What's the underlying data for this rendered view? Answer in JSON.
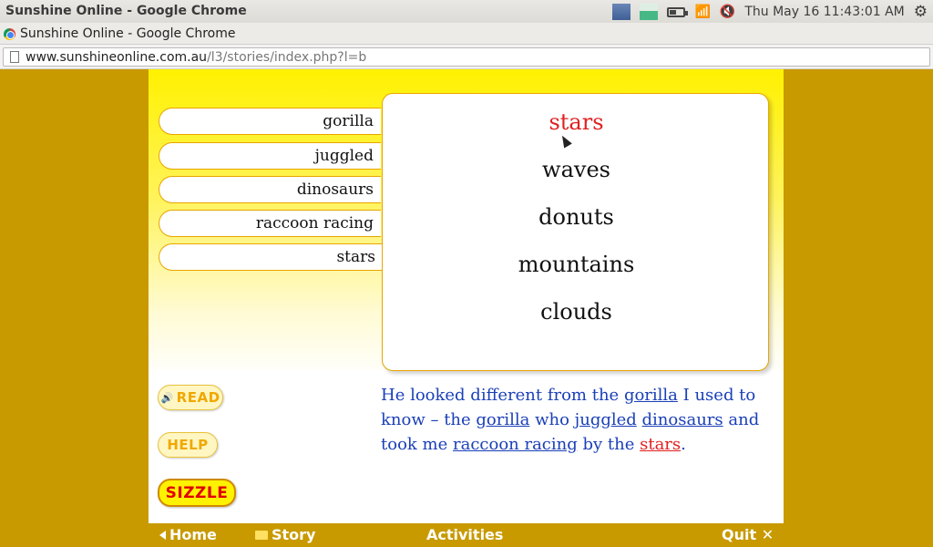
{
  "os": {
    "window_title": "Sunshine Online - Google Chrome",
    "clock": "Thu May 16 11:43:01 AM"
  },
  "browser": {
    "tab_title": "Sunshine Online - Google Chrome",
    "url_host": "www.sunshineonline.com.au",
    "url_path": "/l3/stories/index.php?l=b"
  },
  "word_tabs": [
    {
      "label": "gorilla"
    },
    {
      "label": "juggled"
    },
    {
      "label": "dinosaurs"
    },
    {
      "label": "raccoon racing"
    },
    {
      "label": "stars"
    }
  ],
  "choices": [
    {
      "label": "stars",
      "selected": true
    },
    {
      "label": "waves"
    },
    {
      "label": "donuts"
    },
    {
      "label": "mountains"
    },
    {
      "label": "clouds"
    }
  ],
  "buttons": {
    "read": "READ",
    "help": "HELP",
    "sizzle": "SIZZLE"
  },
  "story": {
    "p1": "He looked different from the ",
    "w1": "gorilla",
    "p2": " I used to know – the ",
    "w2": "gorilla",
    "p3": " who ",
    "w3": "juggled",
    "p4": " ",
    "w4": "dinosaurs",
    "p5": " and took me ",
    "w5": "raccoon racing",
    "p6": " by the ",
    "w6": "stars",
    "p7": "."
  },
  "nav": {
    "home": "Home",
    "story": "Story",
    "activities": "Activities",
    "quit": "Quit ✕"
  },
  "colors": {
    "frame": "#c89a00",
    "selected_text": "#e02020",
    "story_text": "#1a3fb8"
  }
}
